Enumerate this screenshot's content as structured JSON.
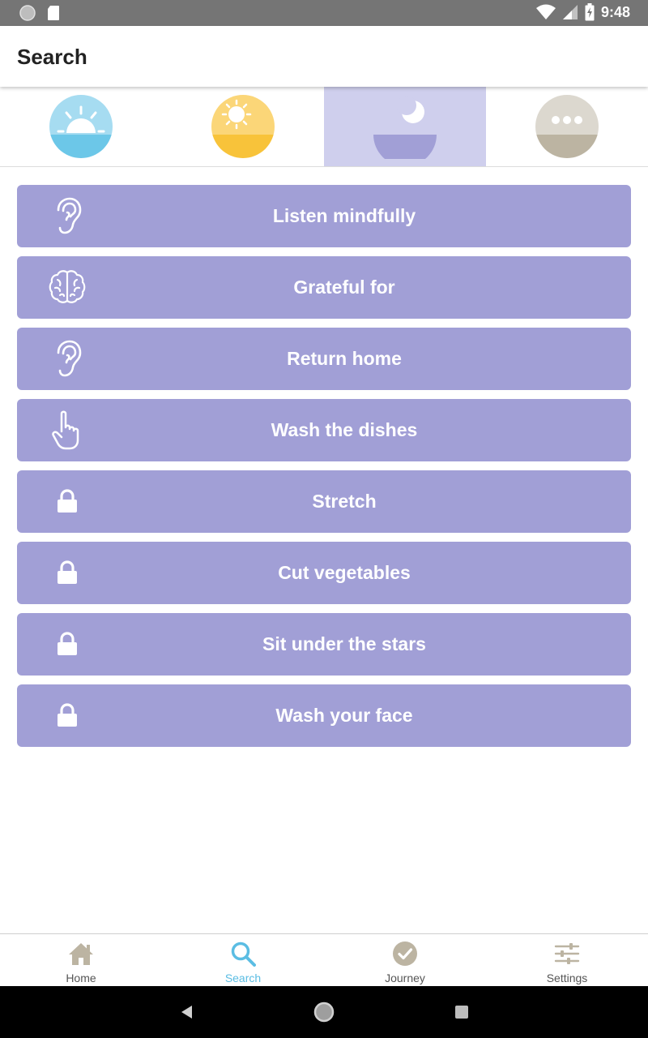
{
  "status_bar": {
    "time": "9:48",
    "icons": [
      "circle-notification-icon",
      "sd-card-icon",
      "wifi-icon",
      "cell-signal-icon",
      "battery-charging-icon"
    ]
  },
  "app_bar": {
    "title": "Search"
  },
  "categories": [
    {
      "name": "sunrise-icon",
      "color": "#6cc7e8",
      "selected": false
    },
    {
      "name": "sun-icon",
      "color": "#f8c33a",
      "selected": false
    },
    {
      "name": "moon-icon",
      "color": "#a19fd6",
      "selected": true
    },
    {
      "name": "more-icon",
      "color": "#bcb4a2",
      "selected": false
    }
  ],
  "list": {
    "color": "#a19fd6",
    "items": [
      {
        "label": "Listen mindfully",
        "icon": "ear-icon",
        "locked": false
      },
      {
        "label": "Grateful for",
        "icon": "brain-icon",
        "locked": false
      },
      {
        "label": "Return home",
        "icon": "ear-icon",
        "locked": false
      },
      {
        "label": "Wash the dishes",
        "icon": "hand-pointer-icon",
        "locked": false
      },
      {
        "label": "Stretch",
        "icon": "lock-icon",
        "locked": true
      },
      {
        "label": "Cut vegetables",
        "icon": "lock-icon",
        "locked": true
      },
      {
        "label": "Sit under the stars",
        "icon": "lock-icon",
        "locked": true
      },
      {
        "label": "Wash your face",
        "icon": "lock-icon",
        "locked": true
      }
    ]
  },
  "bottom_nav": {
    "active_color": "#5bbde3",
    "items": [
      {
        "label": "Home",
        "icon": "home-icon",
        "active": false
      },
      {
        "label": "Search",
        "icon": "search-icon",
        "active": true
      },
      {
        "label": "Journey",
        "icon": "check-circle-icon",
        "active": false
      },
      {
        "label": "Settings",
        "icon": "sliders-icon",
        "active": false
      }
    ]
  },
  "system_nav": [
    "back-icon",
    "home-circle-icon",
    "recents-icon"
  ]
}
